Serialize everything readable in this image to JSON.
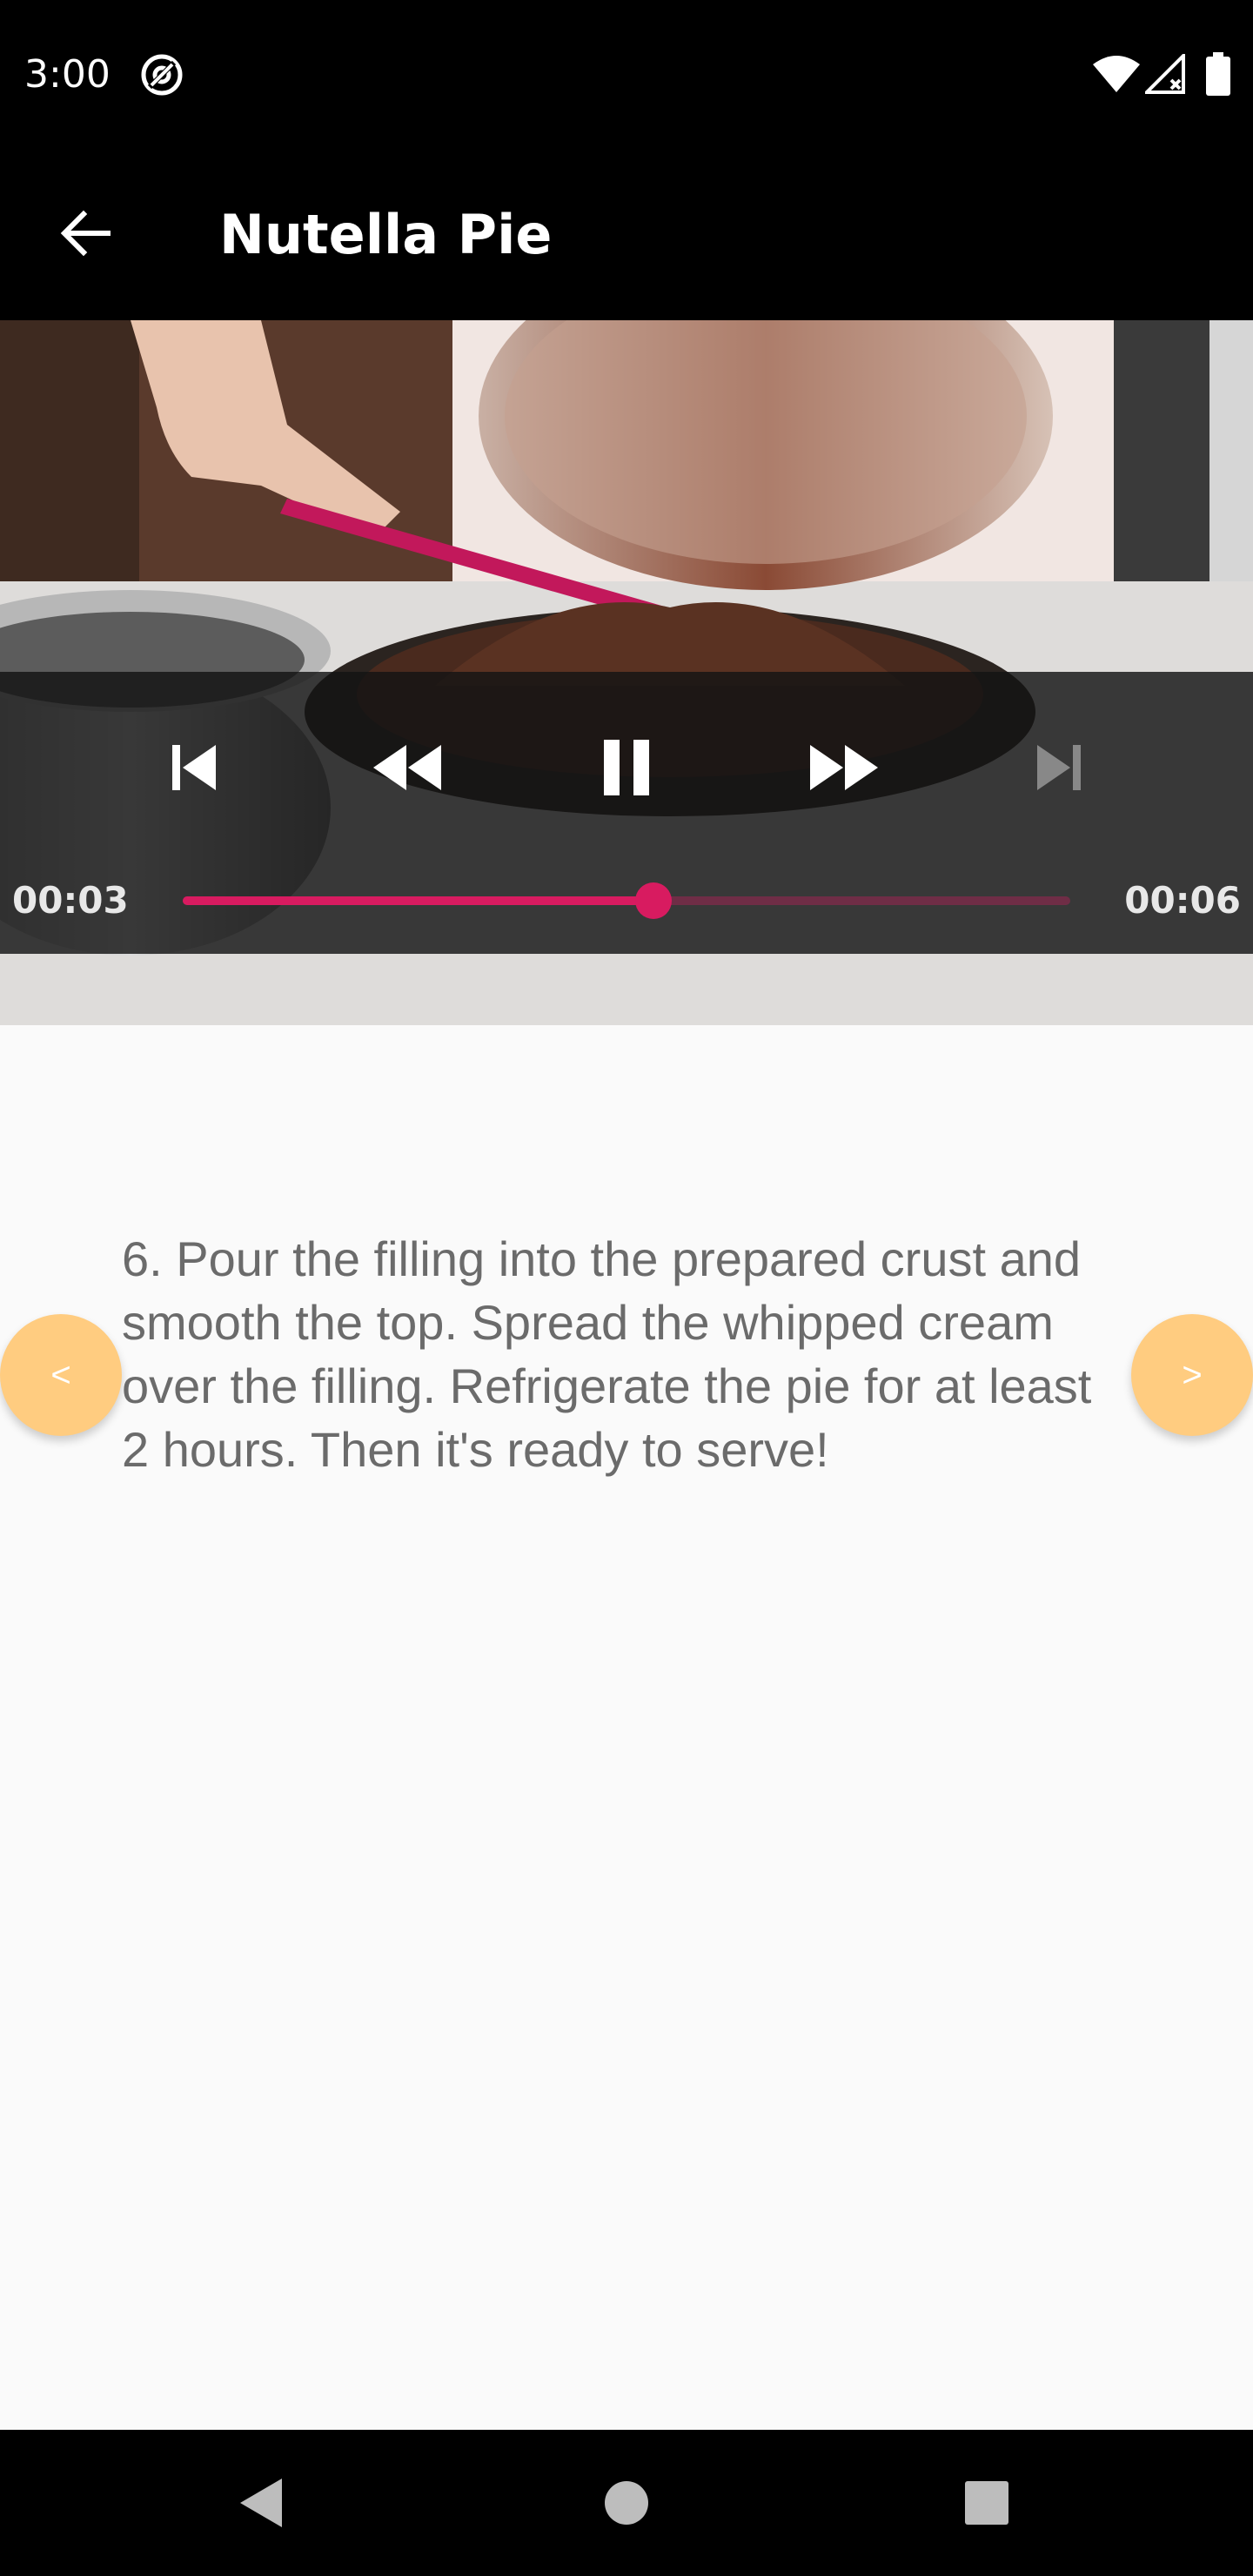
{
  "status_bar": {
    "time": "3:00"
  },
  "app_bar": {
    "title": "Nutella Pie"
  },
  "player": {
    "current_time": "00:03",
    "duration": "00:06",
    "progress": 0.53,
    "accent_color": "#d81b60"
  },
  "step": {
    "text": "6. Pour the filling into the prepared crust and smooth the top. Spread the whipped cream over the filling. Refrigerate the pie for at least 2 hours. Then it's ready to serve!",
    "prev_label": "<",
    "next_label": ">",
    "nav_color": "#ffcc80"
  },
  "icons": {
    "back": "arrow-back-icon",
    "prev": "skip-previous-icon",
    "rewind": "rewind-icon",
    "pause": "pause-icon",
    "fast_forward": "fast-forward-icon",
    "next": "skip-next-icon"
  }
}
